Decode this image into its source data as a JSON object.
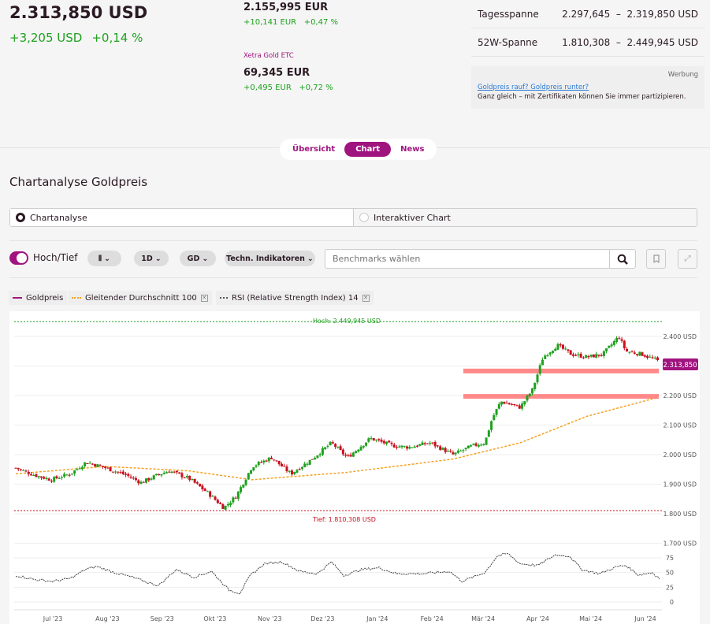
{
  "quote": {
    "price": "2.313,850 USD",
    "change_abs": "+3,205 USD",
    "change_pct": "+0,14 %"
  },
  "eur": {
    "price": "2.155,995 EUR",
    "change_abs": "+10,141 EUR",
    "change_pct": "+0,47 %"
  },
  "etc": {
    "label": "Xetra Gold ETC",
    "price": "69,345 EUR",
    "change_abs": "+0,495 EUR",
    "change_pct": "+0,72 %"
  },
  "spans": [
    {
      "label": "Tagesspanne",
      "low": "2.297,645",
      "high": "2.319,850 USD"
    },
    {
      "label": "52W-Spanne",
      "low": "1.810,308",
      "high": "2.449,945 USD"
    }
  ],
  "ad": {
    "tag": "Werbung",
    "link": "Goldpreis rauf? Goldpreis runter?",
    "text": "Ganz gleich – mit Zertifikaten können Sie immer partizipieren."
  },
  "tabs": [
    "Übersicht",
    "Chart",
    "News"
  ],
  "section_title": "Chartanalyse Goldpreis",
  "mode": {
    "option1": "Chartanalyse",
    "option2": "Interaktiver Chart"
  },
  "toolbar": {
    "toggle_label": "Hoch/Tief",
    "interval": "1D",
    "average": "GD",
    "indicators": "Techn. Indikatoren",
    "bench_placeholder": "Benchmarks wählen"
  },
  "legend": [
    "Goldpreis",
    "Gleitender Durchschnitt 100",
    "RSI (Relative Strength Index) 14"
  ],
  "colors": {
    "brand": "#a0147f",
    "up": "#1ea11e",
    "down": "#c8101e",
    "ma": "#f5a020"
  },
  "chart_data": {
    "type": "candlestick",
    "x_unit": "days since 2023-07-01",
    "xticks": [
      {
        "label": "Jul '23",
        "d": 0
      },
      {
        "label": "Aug '23",
        "d": 31
      },
      {
        "label": "Sep '23",
        "d": 62
      },
      {
        "label": "Okt '23",
        "d": 92
      },
      {
        "label": "Nov '23",
        "d": 123
      },
      {
        "label": "Dez '23",
        "d": 153
      },
      {
        "label": "Jan '24",
        "d": 184
      },
      {
        "label": "Feb '24",
        "d": 215
      },
      {
        "label": "Mär '24",
        "d": 244
      },
      {
        "label": "Apr '24",
        "d": 275
      },
      {
        "label": "Mai '24",
        "d": 305
      },
      {
        "label": "Jun '24",
        "d": 336
      }
    ],
    "yticks": [
      "2.400 USD",
      "2.300 USD",
      "2.200 USD",
      "2.100 USD",
      "2.000 USD",
      "1.900 USD",
      "1.800 USD",
      "1.700 USD"
    ],
    "ytick_values": [
      2400,
      2300,
      2200,
      2100,
      2000,
      1900,
      1800,
      1700
    ],
    "ylim": [
      1700,
      2450
    ],
    "high_label": "Hoch: 2.449,945 USD",
    "high": 2449.945,
    "low_label": "Tief: 1.810,308 USD",
    "low": 1810.308,
    "last_label": "2.313,850",
    "last": 2313.85,
    "support_levels": [
      2283,
      2197
    ],
    "close_points": [
      [
        -21,
        1955
      ],
      [
        -10,
        1930
      ],
      [
        -1,
        1915
      ],
      [
        10,
        1935
      ],
      [
        19,
        1975
      ],
      [
        30,
        1955
      ],
      [
        42,
        1930
      ],
      [
        50,
        1905
      ],
      [
        59,
        1930
      ],
      [
        66,
        1945
      ],
      [
        77,
        1920
      ],
      [
        88,
        1870
      ],
      [
        97,
        1820
      ],
      [
        104,
        1860
      ],
      [
        113,
        1960
      ],
      [
        124,
        1990
      ],
      [
        135,
        1935
      ],
      [
        147,
        1985
      ],
      [
        158,
        2040
      ],
      [
        167,
        1990
      ],
      [
        180,
        2055
      ],
      [
        193,
        2030
      ],
      [
        202,
        2025
      ],
      [
        214,
        2040
      ],
      [
        227,
        2000
      ],
      [
        238,
        2030
      ],
      [
        245,
        2040
      ],
      [
        249,
        2120
      ],
      [
        254,
        2180
      ],
      [
        265,
        2160
      ],
      [
        272,
        2220
      ],
      [
        278,
        2330
      ],
      [
        286,
        2370
      ],
      [
        294,
        2340
      ],
      [
        303,
        2330
      ],
      [
        312,
        2340
      ],
      [
        321,
        2400
      ],
      [
        325,
        2350
      ],
      [
        334,
        2340
      ],
      [
        342,
        2320
      ],
      [
        344,
        2314
      ]
    ],
    "ma100_points": [
      [
        -21,
        1935
      ],
      [
        30,
        1960
      ],
      [
        77,
        1945
      ],
      [
        113,
        1915
      ],
      [
        167,
        1940
      ],
      [
        227,
        1985
      ],
      [
        265,
        2040
      ],
      [
        303,
        2130
      ],
      [
        344,
        2195
      ]
    ],
    "rsi_ticks": [
      "75",
      "50",
      "25",
      "0"
    ],
    "rsi_tick_values": [
      75,
      50,
      25,
      0
    ],
    "rsi_points": [
      [
        -21,
        45
      ],
      [
        -10,
        38
      ],
      [
        0,
        35
      ],
      [
        10,
        40
      ],
      [
        19,
        56
      ],
      [
        25,
        60
      ],
      [
        35,
        50
      ],
      [
        45,
        42
      ],
      [
        55,
        32
      ],
      [
        60,
        28
      ],
      [
        70,
        55
      ],
      [
        80,
        42
      ],
      [
        90,
        52
      ],
      [
        100,
        20
      ],
      [
        106,
        15
      ],
      [
        112,
        45
      ],
      [
        120,
        65
      ],
      [
        130,
        68
      ],
      [
        140,
        52
      ],
      [
        150,
        48
      ],
      [
        158,
        68
      ],
      [
        165,
        45
      ],
      [
        175,
        55
      ],
      [
        185,
        58
      ],
      [
        195,
        48
      ],
      [
        210,
        48
      ],
      [
        225,
        52
      ],
      [
        232,
        35
      ],
      [
        245,
        50
      ],
      [
        252,
        78
      ],
      [
        258,
        82
      ],
      [
        265,
        65
      ],
      [
        275,
        62
      ],
      [
        285,
        80
      ],
      [
        293,
        78
      ],
      [
        300,
        55
      ],
      [
        310,
        48
      ],
      [
        320,
        60
      ],
      [
        325,
        62
      ],
      [
        332,
        46
      ],
      [
        340,
        50
      ],
      [
        344,
        40
      ]
    ]
  }
}
